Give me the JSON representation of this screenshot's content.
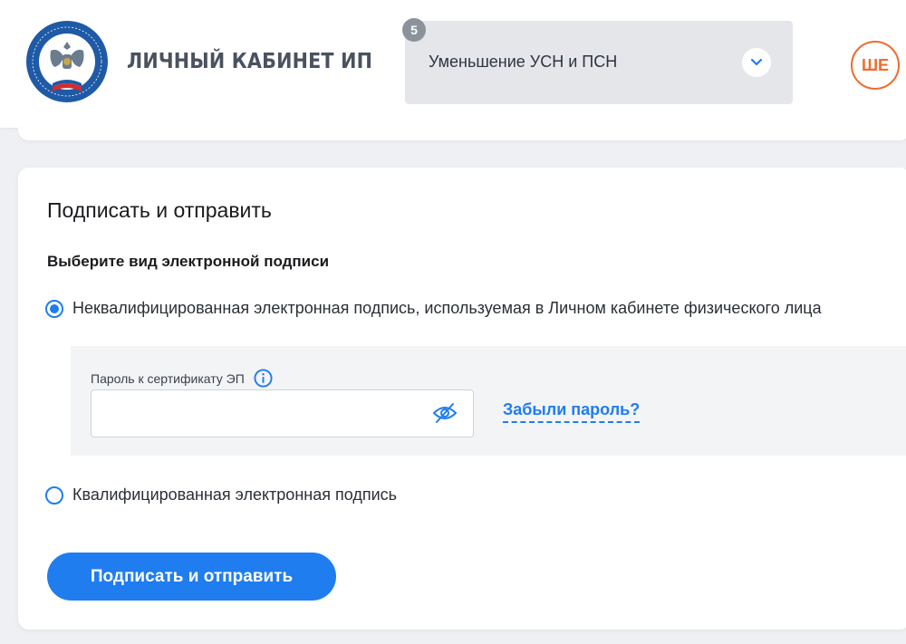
{
  "header": {
    "title": "ЛИЧНЫЙ КАБИНЕТ ИП",
    "logo_icon": "fns-emblem-icon",
    "service_select": {
      "step_badge": "5",
      "selected": "Уменьшение УСН и ПСН"
    },
    "avatar_initials": "ШЕ"
  },
  "card": {
    "title": "Подписать и отправить",
    "signature_type_label": "Выберите вид электронной подписи",
    "options": [
      {
        "label": "Неквалифицированная электронная подпись, используемая в Личном кабинете физического лица",
        "checked": true
      },
      {
        "label": "Квалифицированная электронная подпись",
        "checked": false
      }
    ],
    "password_field": {
      "label": "Пароль к сертификату ЭП",
      "value": "",
      "placeholder": ""
    },
    "forgot_password_link": "Забыли пароль?",
    "submit_button": "Подписать и отправить"
  },
  "colors": {
    "accent": "#1f7df0",
    "avatar": "#ee6b2d",
    "header_title": "#4a5260",
    "select_bg": "#e4e6ea",
    "page_bg": "#eef0f3"
  }
}
